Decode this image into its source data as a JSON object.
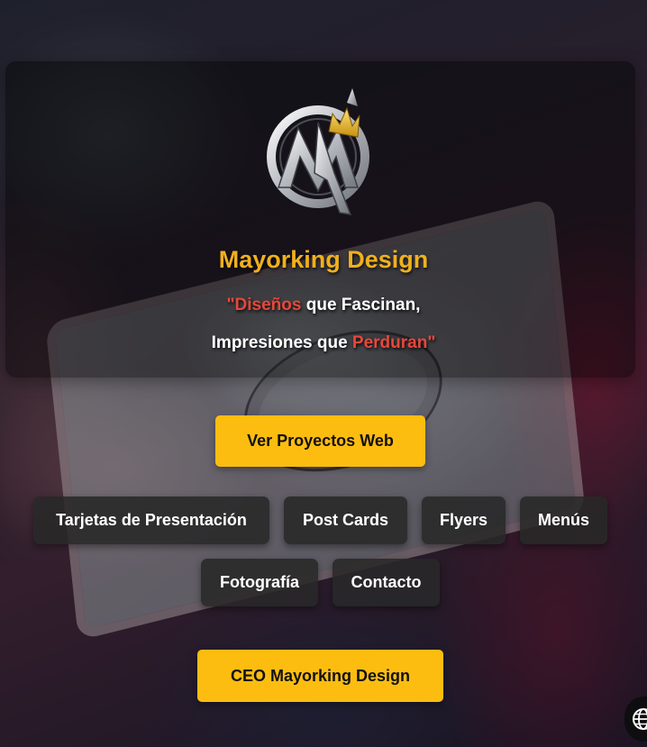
{
  "site": {
    "brand_title": "Mayorking Design",
    "tagline_line1": {
      "quote_open": "\"",
      "accent1": "Diseños",
      "rest1": " que Fascinan,"
    },
    "tagline_line2": {
      "lead": "Impresiones que ",
      "accent2": "Perduran",
      "quote_close": "\""
    }
  },
  "buttons": {
    "web_projects": "Ver Proyectos Web",
    "nav": [
      {
        "label": "Tarjetas de Presentación"
      },
      {
        "label": "Post Cards"
      },
      {
        "label": "Flyers"
      },
      {
        "label": "Menús"
      },
      {
        "label": "Fotografía"
      },
      {
        "label": "Contacto"
      }
    ],
    "ceo": "CEO Mayorking Design"
  },
  "icons": {
    "logo": "mk-crown-logo",
    "globe": "globe-icon"
  },
  "colors": {
    "brand_gold": "#f0b01e",
    "accent_red": "#e8473a",
    "button_yellow": "#fdbd10",
    "button_dark": "#282828"
  }
}
